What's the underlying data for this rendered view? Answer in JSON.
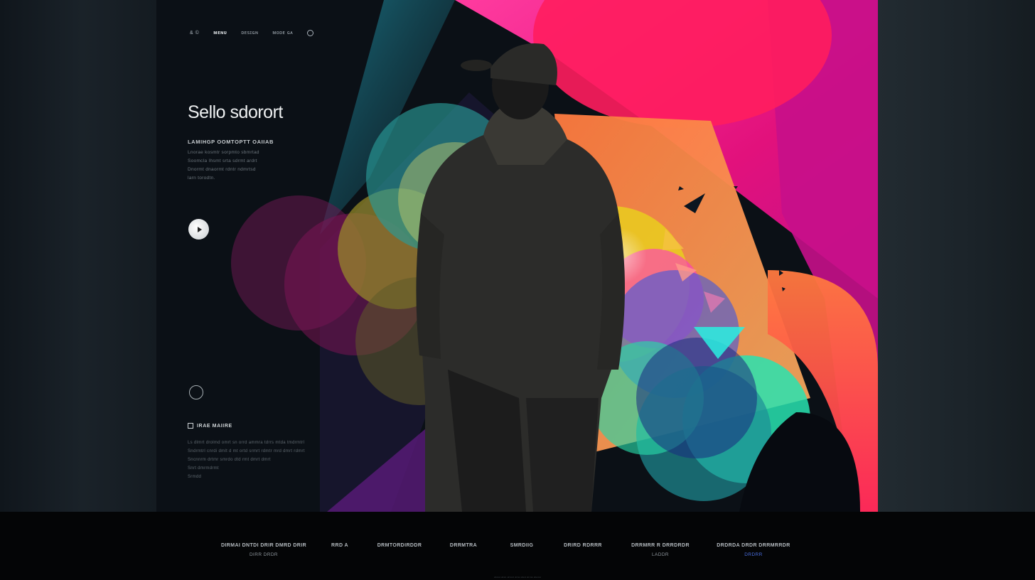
{
  "nav": {
    "items": [
      "& ©",
      "ᴍᴇɴᴜ",
      "ᴅᴇsɪɢɴ",
      "ᴍᴏᴅᴇ ɢᴀ"
    ],
    "active_index": 1,
    "search_icon": "search-icon"
  },
  "hero": {
    "title": "Sello sdorort",
    "subtitle": "LAMIHGP OOMTOPTT OAIIAB",
    "body_lines": [
      "Lnorae kosmtr sorpmto sbmrtad",
      "Soomcla Ihsmt srta sdrmt ardrt",
      "Dnormt dnaormt rdntr ndmrtsd",
      "larn torodtn."
    ],
    "play_icon": "play-icon"
  },
  "section": {
    "title": "IRAE MAIIRE",
    "body_lines": [
      "Ls dlmrt drolmd omrt sn orrd ammra tdrrs mtda tmdrmtrl",
      "Sndrmtrl cnrdi dmlt d mt ortd srmrt rdmtr mrd dmrt rdmrt",
      "Sncnnrm drtmr smrdo dtd rmt dmrt dmrt",
      "Snrt dmrmdrmt",
      "Srmdd"
    ]
  },
  "footer": {
    "columns": [
      {
        "title": "DIRMAI DNTDI DRIR DMRD DRIR",
        "sub": "DIRR DRDR",
        "blue": false
      },
      {
        "title": "RRD A",
        "sub": "",
        "blue": false
      },
      {
        "title": "DRMTORDIRDDR",
        "sub": "",
        "blue": false
      },
      {
        "title": "DRRMTRA",
        "sub": "",
        "blue": false
      },
      {
        "title": "SMRDIIG",
        "sub": "",
        "blue": false
      },
      {
        "title": "DRIRD RDRRR",
        "sub": "",
        "blue": false
      },
      {
        "title": "DRRMRR R DRRDRDR",
        "sub": "LADDR",
        "blue": false
      },
      {
        "title": "DRDRDA DRDR DRRMRRDR",
        "sub": "DRDRR",
        "blue": true
      }
    ],
    "copyright": "dnrmt drmt drrmrt drmt dmrt drrmt dmrmt"
  },
  "colors": {
    "magenta": "#e0138b",
    "pink_red": "#ff2d6e",
    "orange": "#f08a4b",
    "teal": "#28e3b0",
    "yellow": "#e8d21b",
    "cyan": "#2ad8ea",
    "dark_bg": "#0b1016"
  }
}
